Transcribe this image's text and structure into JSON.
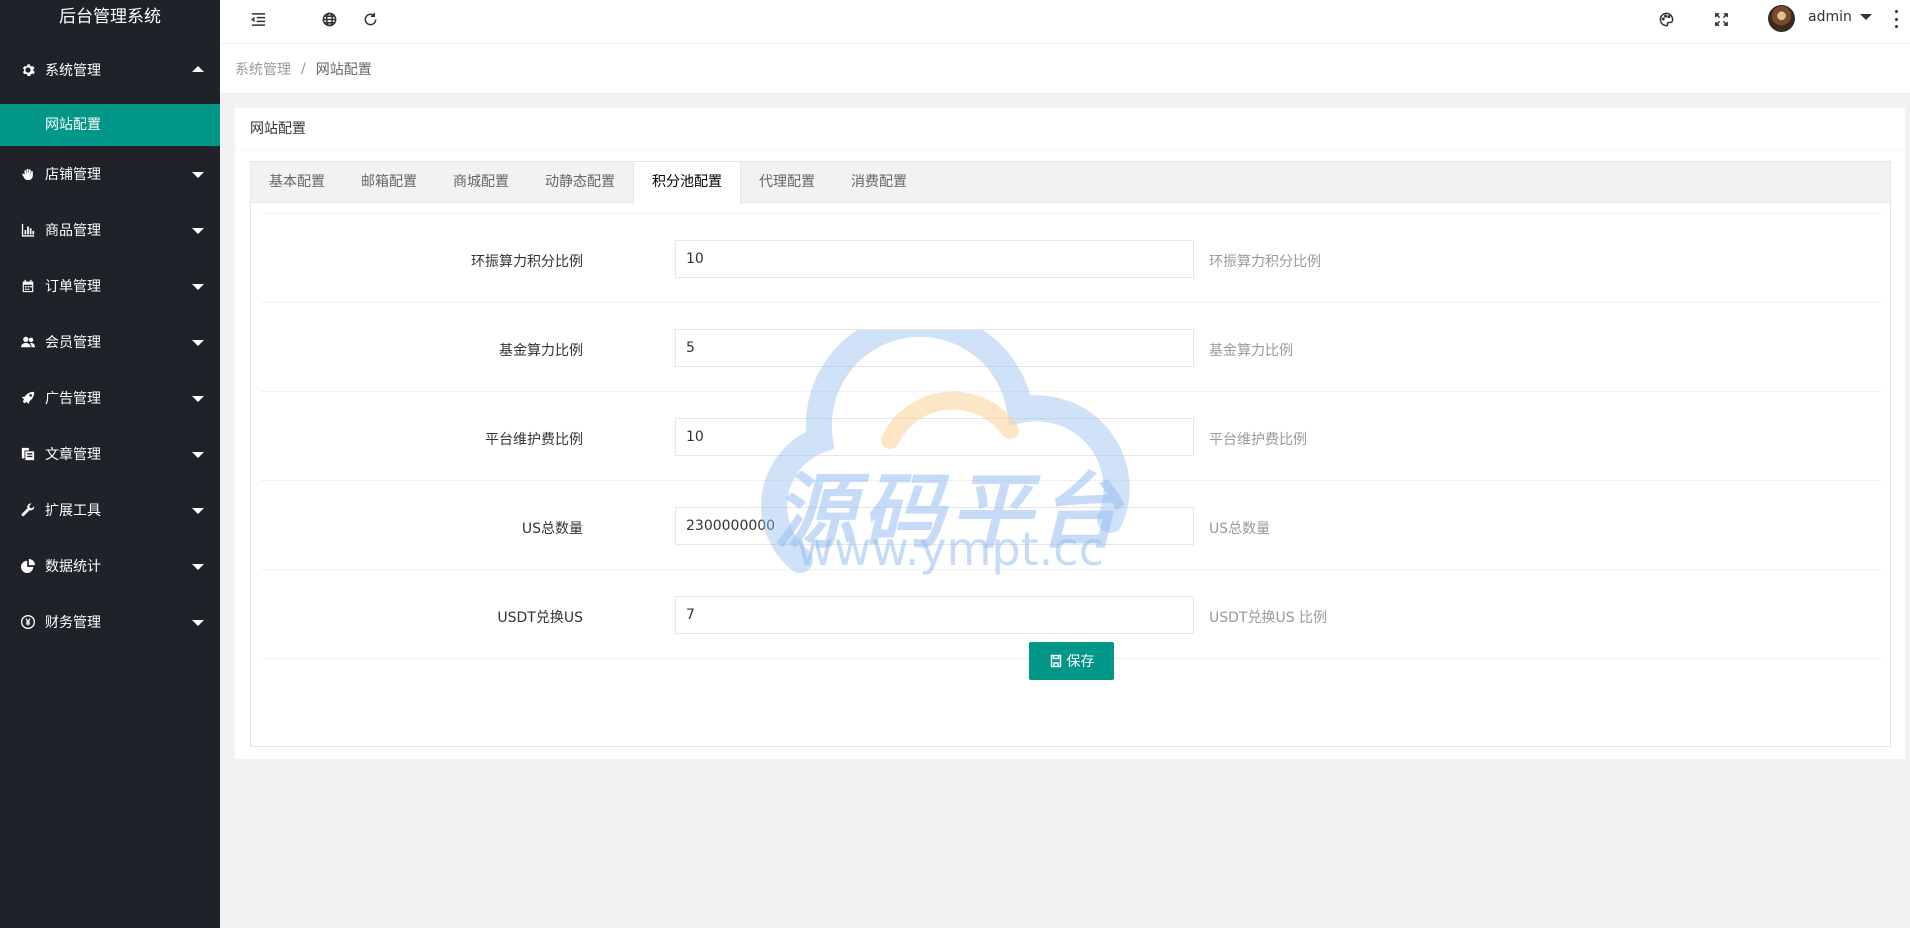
{
  "sidebar": {
    "logo": "后台管理系统",
    "items": [
      {
        "label": "系统管理",
        "icon": "gear-icon",
        "open": true
      },
      {
        "label": "店铺管理",
        "icon": "hand-icon"
      },
      {
        "label": "商品管理",
        "icon": "chart-icon"
      },
      {
        "label": "订单管理",
        "icon": "calendar-icon"
      },
      {
        "label": "会员管理",
        "icon": "users-icon"
      },
      {
        "label": "广告管理",
        "icon": "rocket-icon"
      },
      {
        "label": "文章管理",
        "icon": "copy-icon"
      },
      {
        "label": "扩展工具",
        "icon": "wrench-icon"
      },
      {
        "label": "数据统计",
        "icon": "pie-icon"
      },
      {
        "label": "财务管理",
        "icon": "yen-icon"
      }
    ],
    "sub_active": "网站配置"
  },
  "header": {
    "user": "admin"
  },
  "breadcrumb": {
    "parent": "系统管理",
    "sep": "/",
    "current": "网站配置"
  },
  "card": {
    "title": "网站配置",
    "tabs": [
      "基本配置",
      "邮箱配置",
      "商城配置",
      "动静态配置",
      "积分池配置",
      "代理配置",
      "消费配置"
    ],
    "active_tab": "积分池配置",
    "fields": [
      {
        "label": "环振算力积分比例",
        "value": "10",
        "tip": "环振算力积分比例"
      },
      {
        "label": "基金算力比例",
        "value": "5",
        "tip": "基金算力比例"
      },
      {
        "label": "平台维护费比例",
        "value": "10",
        "tip": "平台维护费比例"
      },
      {
        "label": "US总数量",
        "value": "2300000000",
        "tip": "US总数量"
      },
      {
        "label": "USDT兑换US",
        "value": "7",
        "tip": "USDT兑换US 比例"
      }
    ],
    "save_label": "保存"
  },
  "watermark": {
    "text": "源码平台",
    "url": "www.ympt.cc"
  },
  "colors": {
    "sidebar_bg": "#20222a",
    "accent": "#009688"
  }
}
